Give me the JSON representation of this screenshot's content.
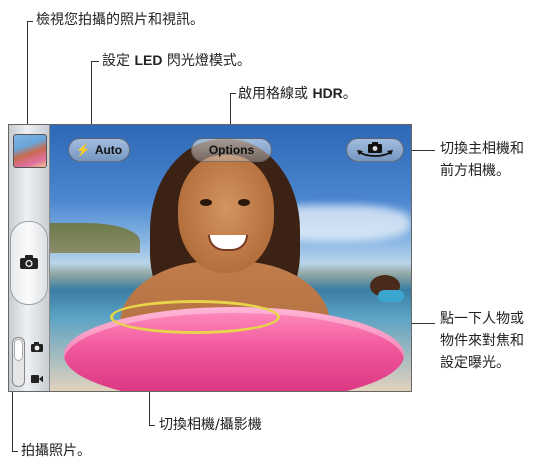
{
  "callouts": {
    "view_photos": "檢視您拍攝的照片和視訊。",
    "flash_mode_prefix": "設定",
    "flash_mode_bold": "LED",
    "flash_mode_suffix": "閃光燈模式。",
    "options_prefix": "啟用格線或",
    "options_bold": "HDR",
    "options_suffix": "。",
    "switch_camera": "切換主相機和\n前方相機。",
    "focus": "點一下人物或\n物件來對焦和\n設定曝光。",
    "camera_video": "切換相機/攝影機",
    "take_photo": "拍攝照片。"
  },
  "overlay": {
    "flash_label": "Auto",
    "options_label": "Options"
  },
  "icons": {
    "flash": "lightning-bolt-icon",
    "switch_camera": "camera-rotate-icon",
    "shutter": "camera-icon",
    "photo_mode": "camera-icon",
    "video_mode": "video-camera-icon"
  },
  "camera_mode": "photo"
}
